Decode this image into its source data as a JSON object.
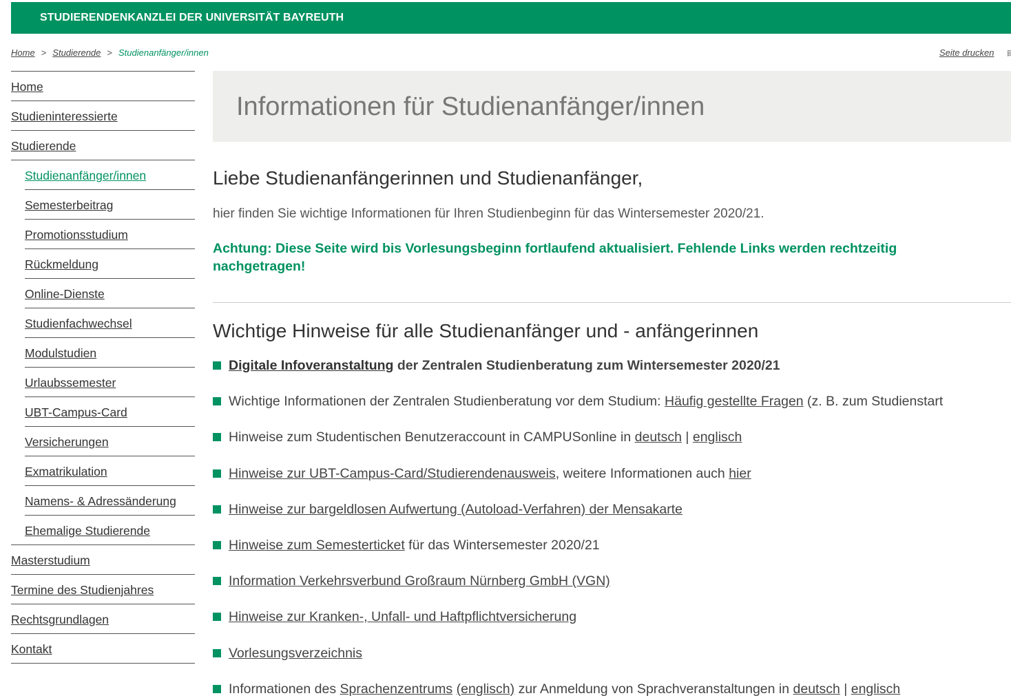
{
  "header": {
    "title": "STUDIERENDENKANZLEI DER UNIVERSITÄT BAYREUTH"
  },
  "breadcrumb": {
    "items": [
      "Home",
      "Studierende",
      "Studienanfänger/innen"
    ],
    "separator": ">"
  },
  "print_link": "Seite drucken",
  "sidebar": {
    "items": [
      {
        "label": "Home"
      },
      {
        "label": "Studieninteressierte"
      },
      {
        "label": "Studierende"
      },
      {
        "label": "Studienanfänger/innen"
      },
      {
        "label": "Semesterbeitrag"
      },
      {
        "label": "Promotionsstudium"
      },
      {
        "label": "Rückmeldung"
      },
      {
        "label": "Online-Dienste"
      },
      {
        "label": "Studienfachwechsel"
      },
      {
        "label": "Modulstudien"
      },
      {
        "label": "Urlaubssemester"
      },
      {
        "label": "UBT-Campus-Card"
      },
      {
        "label": "Versicherungen"
      },
      {
        "label": "Exmatrikulation"
      },
      {
        "label": "Namens- & Adressänderung"
      },
      {
        "label": "Ehemalige Studierende"
      },
      {
        "label": "Masterstudium"
      },
      {
        "label": "Termine des Studienjahres"
      },
      {
        "label": "Rechtsgrundlagen"
      },
      {
        "label": "Kontakt"
      }
    ]
  },
  "main": {
    "page_title": "Informationen für Studienanfänger/innen",
    "greeting": "Liebe Studienanfängerinnen und Studienanfänger,",
    "intro": "hier finden Sie wichtige Informationen für Ihren Studienbeginn für das Wintersemester 2020/21.",
    "notice": "Achtung: Diese Seite wird bis Vorlesungsbeginn fortlaufend aktualisiert. Fehlende Links werden rechtzeitig nachgetragen!",
    "section_title": "Wichtige Hinweise für alle Studienanfänger und - anfängerinnen",
    "list": [
      {
        "link1": "Digitale Infoveranstaltung",
        "text1": " der Zentralen Studienberatung zum Wintersemester 2020/21"
      },
      {
        "text1": "Wichtige Informationen der Zentralen Studienberatung vor dem Studium: ",
        "link1": "Häufig gestellte Fragen",
        "text2": " (z. B. zum Studienstart"
      },
      {
        "text1": "Hinweise zum Studentischen Benutzeraccount in CAMPUSonline in ",
        "link1": "deutsch",
        "text2": " | ",
        "link2": "englisch"
      },
      {
        "link1": "Hinweise zur UBT-Campus-Card/Studierendenausweis",
        "text1": ", weitere Informationen auch ",
        "link2": "hier"
      },
      {
        "link1": "Hinweise zur bargeldlosen Aufwertung (Autoload-Verfahren) der Mensakarte"
      },
      {
        "link1": "Hinweise zum Semesterticket",
        "text1": " für das Wintersemester 2020/21"
      },
      {
        "link1": "Information Verkehrsverbund Großraum Nürnberg GmbH (VGN)"
      },
      {
        "link1": "Hinweise zur Kranken-, Unfall- und Haftpflichtversicherung"
      },
      {
        "link1": "Vorlesungsverzeichnis"
      },
      {
        "text1": "Informationen des ",
        "link1": "Sprachenzentrums",
        "text2": " ",
        "link2": "(englisch)",
        "text3": " zur Anmeldung von Sprachveranstaltungen in ",
        "link3": "deutsch",
        "text4": " | ",
        "link4": "englisch"
      }
    ]
  },
  "colors": {
    "brand": "#009260",
    "hero_bg": "#eeeeec"
  }
}
